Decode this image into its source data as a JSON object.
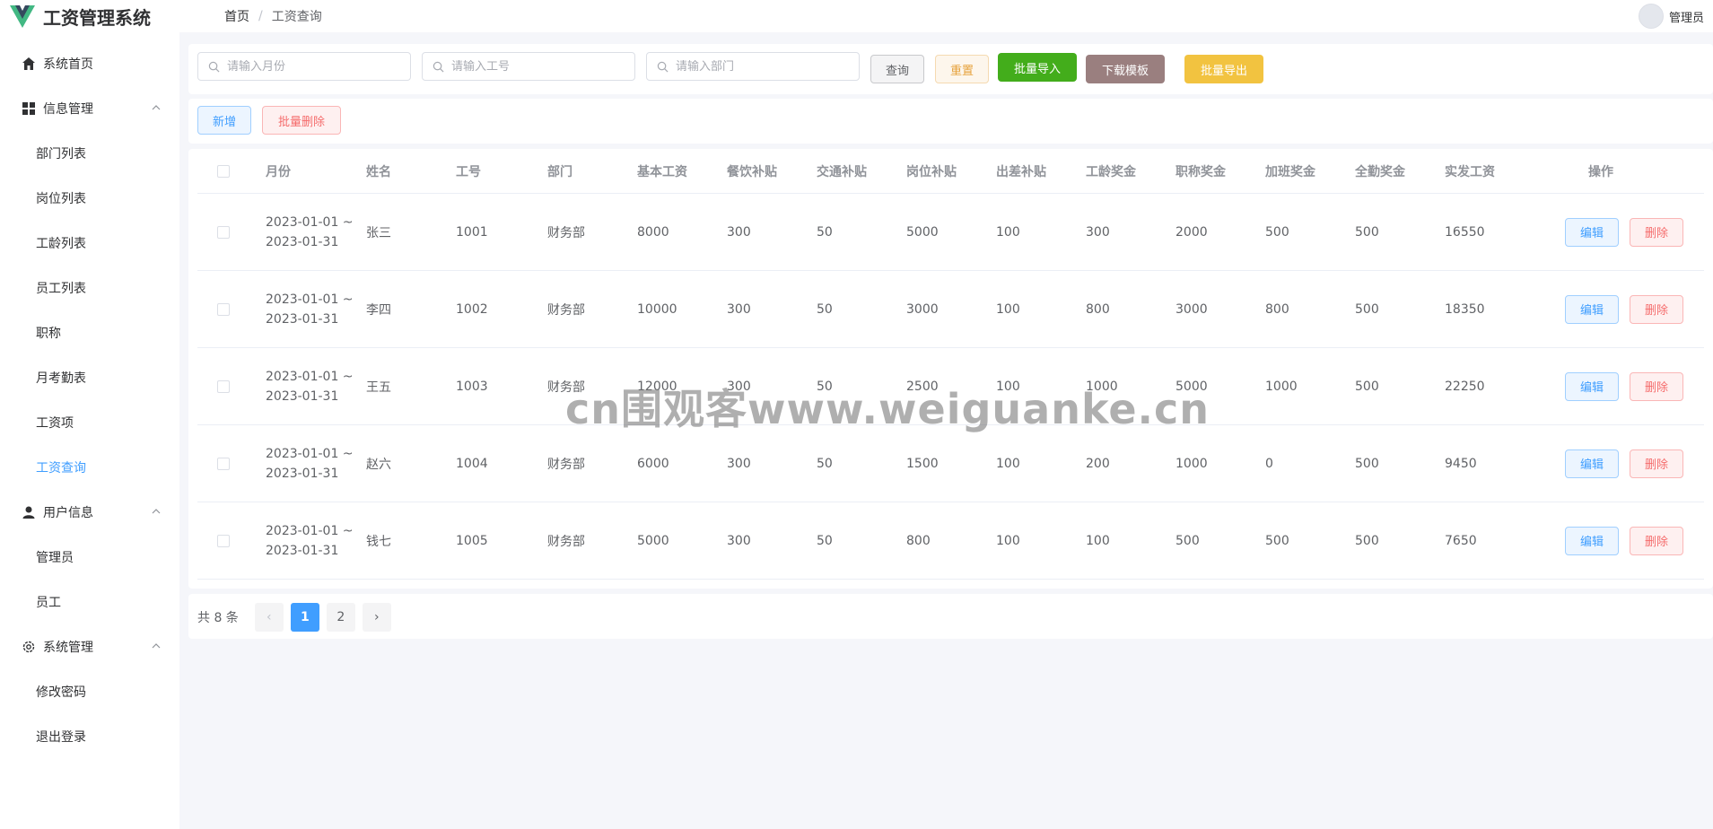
{
  "app": {
    "title": "工资管理系统"
  },
  "breadcrumb": {
    "home": "首页",
    "separator": "/",
    "current": "工资查询"
  },
  "user": {
    "name": "管理员"
  },
  "sidebar": {
    "home": "系统首页",
    "groups": [
      {
        "label": "信息管理",
        "items": [
          "部门列表",
          "岗位列表",
          "工龄列表",
          "员工列表",
          "职称",
          "月考勤表",
          "工资项",
          "工资查询"
        ]
      },
      {
        "label": "用户信息",
        "items": [
          "管理员",
          "员工"
        ]
      },
      {
        "label": "系统管理",
        "items": [
          "修改密码",
          "退出登录"
        ]
      }
    ],
    "active": "工资查询"
  },
  "search": {
    "month_placeholder": "请输入月份",
    "empno_placeholder": "请输入工号",
    "dept_placeholder": "请输入部门",
    "query": "查询",
    "reset": "重置",
    "import": "批量导入",
    "template": "下载模板",
    "export": "批量导出"
  },
  "actions": {
    "add": "新增",
    "batch_delete": "批量删除"
  },
  "table": {
    "headers": [
      "月份",
      "姓名",
      "工号",
      "部门",
      "基本工资",
      "餐饮补贴",
      "交通补贴",
      "岗位补贴",
      "出差补贴",
      "工龄奖金",
      "职称奖金",
      "加班奖金",
      "全勤奖金",
      "实发工资",
      "操作"
    ],
    "edit": "编辑",
    "delete": "删除",
    "rows": [
      {
        "month": "2023-01-01 ~ 2023-01-31",
        "name": "张三",
        "no": "1001",
        "dept": "财务部",
        "basic": "8000",
        "meal": "300",
        "traffic": "50",
        "post": "5000",
        "trip": "100",
        "seniority": "300",
        "title": "2000",
        "overtime": "500",
        "attendance": "500",
        "net": "16550"
      },
      {
        "month": "2023-01-01 ~ 2023-01-31",
        "name": "李四",
        "no": "1002",
        "dept": "财务部",
        "basic": "10000",
        "meal": "300",
        "traffic": "50",
        "post": "3000",
        "trip": "100",
        "seniority": "800",
        "title": "3000",
        "overtime": "800",
        "attendance": "500",
        "net": "18350"
      },
      {
        "month": "2023-01-01 ~ 2023-01-31",
        "name": "王五",
        "no": "1003",
        "dept": "财务部",
        "basic": "12000",
        "meal": "300",
        "traffic": "50",
        "post": "2500",
        "trip": "100",
        "seniority": "1000",
        "title": "5000",
        "overtime": "1000",
        "attendance": "500",
        "net": "22250"
      },
      {
        "month": "2023-01-01 ~ 2023-01-31",
        "name": "赵六",
        "no": "1004",
        "dept": "财务部",
        "basic": "6000",
        "meal": "300",
        "traffic": "50",
        "post": "1500",
        "trip": "100",
        "seniority": "200",
        "title": "1000",
        "overtime": "0",
        "attendance": "500",
        "net": "9450"
      },
      {
        "month": "2023-01-01 ~ 2023-01-31",
        "name": "钱七",
        "no": "1005",
        "dept": "财务部",
        "basic": "5000",
        "meal": "300",
        "traffic": "50",
        "post": "800",
        "trip": "100",
        "seniority": "100",
        "title": "500",
        "overtime": "500",
        "attendance": "500",
        "net": "7650"
      }
    ]
  },
  "pager": {
    "total": "共 8 条",
    "prev": "‹",
    "next": "›",
    "pages": [
      "1",
      "2"
    ],
    "current": "1"
  },
  "watermark": "cn围观客www.weiguanke.cn",
  "colors": {
    "primary": "#409eff",
    "danger": "#f56c6c",
    "import": "#43ad1b",
    "template": "#9a7f7f",
    "export": "#f2c340",
    "logo": "#42b883"
  }
}
